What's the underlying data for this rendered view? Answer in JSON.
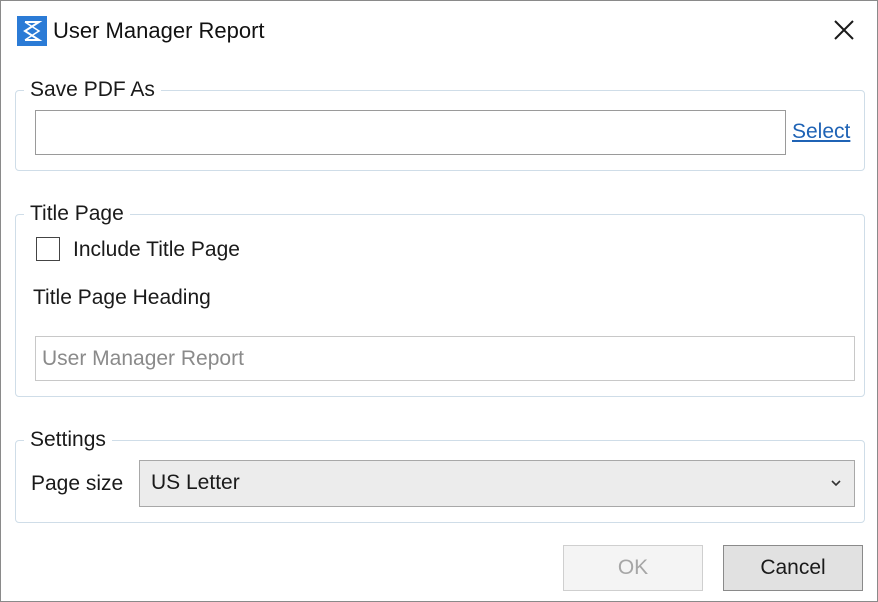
{
  "window": {
    "title": "User Manager Report",
    "app_icon": "app-logo-icon",
    "close_icon": "close-icon",
    "accent_color": "#2b7bd6"
  },
  "save_pdf": {
    "legend": "Save PDF As",
    "path_value": "",
    "path_placeholder": "",
    "select_link": "Select"
  },
  "title_page": {
    "legend": "Title Page",
    "include_label": "Include Title Page",
    "include_checked": false,
    "heading_label": "Title Page Heading",
    "heading_value": "",
    "heading_placeholder": "User Manager Report"
  },
  "settings": {
    "legend": "Settings",
    "page_size_label": "Page size",
    "page_size_value": "US Letter",
    "dropdown_icon": "chevron-down-icon"
  },
  "buttons": {
    "ok": "OK",
    "ok_enabled": false,
    "cancel": "Cancel"
  }
}
